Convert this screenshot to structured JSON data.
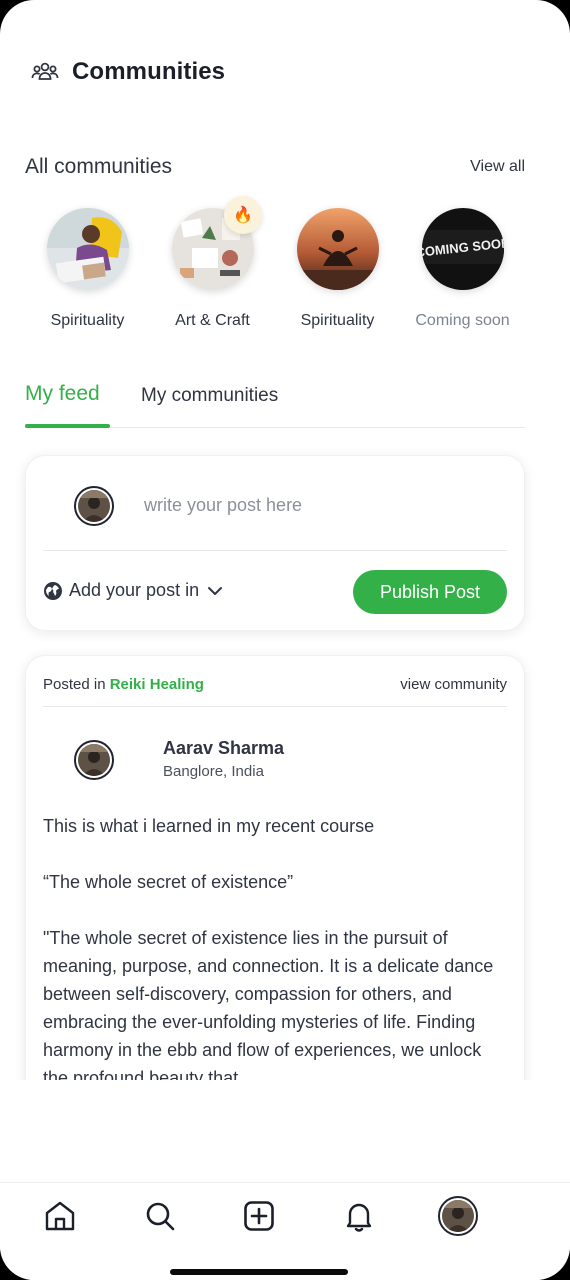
{
  "header": {
    "title": "Communities",
    "icon": "people-group-icon"
  },
  "all_communities": {
    "title": "All communities",
    "view_all": "View all",
    "items": [
      {
        "label": "Spirituality",
        "muted": false
      },
      {
        "label": "Art & Craft",
        "muted": false,
        "badge": "🔥"
      },
      {
        "label": "Spirituality",
        "muted": false
      },
      {
        "label": "Coming soon",
        "muted": true,
        "image_text": "COMING SOON"
      }
    ]
  },
  "tabs": [
    {
      "label": "My feed",
      "active": true
    },
    {
      "label": "My communities",
      "active": false
    }
  ],
  "composer": {
    "placeholder": "write your post here",
    "add_post_in": "Add your post in",
    "publish_label": "Publish Post"
  },
  "post": {
    "posted_in_prefix": "Posted in",
    "community": "Reiki Healing",
    "view_community": "view community",
    "author": "Aarav Sharma",
    "location": "Banglore, India",
    "paragraphs": [
      "This is what i learned in my recent course",
      "“The whole secret of existence”",
      "\"The whole secret of existence lies in the pursuit of meaning, purpose, and connection. It is a delicate dance between self-discovery, compassion for others, and embracing the ever-unfolding mysteries of life. Finding harmony in the ebb and flow of experiences, we unlock the profound beauty that"
    ]
  },
  "bottom_nav": [
    {
      "name": "home-icon"
    },
    {
      "name": "search-icon"
    },
    {
      "name": "add-post-icon"
    },
    {
      "name": "bell-icon"
    },
    {
      "name": "profile-avatar"
    }
  ],
  "colors": {
    "accent": "#34b049",
    "text": "#2f3542",
    "muted": "#7c8391"
  }
}
